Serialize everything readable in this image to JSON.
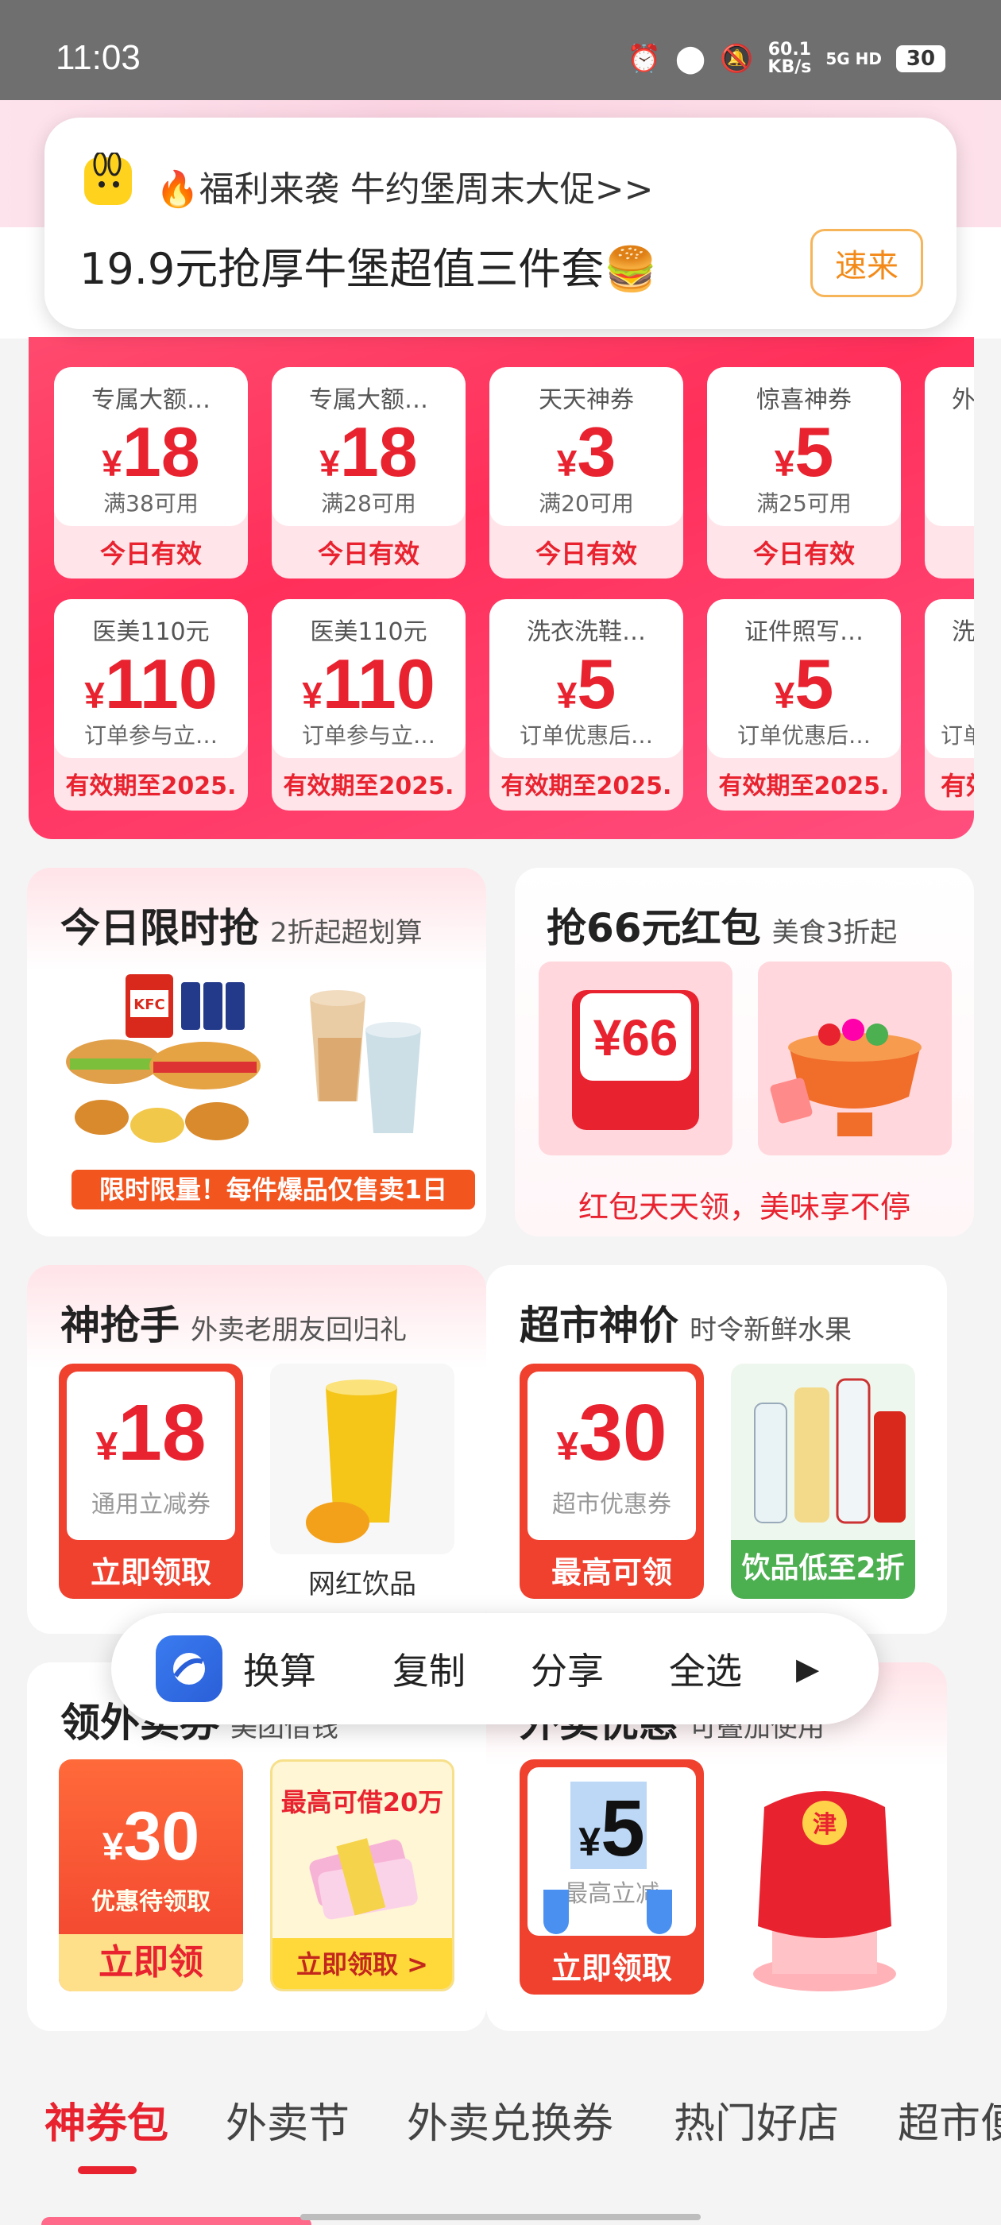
{
  "status_bar": {
    "time": "11:03",
    "net_speed": "60.1",
    "net_unit": "KB/s",
    "signal": "5G HD",
    "battery": "30"
  },
  "notification": {
    "line1": "🔥福利来袭 牛约堡周末大促>>",
    "line2": "19.9元抢厚牛堡超值三件套🍔",
    "button": "速来"
  },
  "coupons_row1": [
    {
      "title": "专属大额…",
      "yen": "¥",
      "amount": "18",
      "cond": "满38可用",
      "valid": "今日有效"
    },
    {
      "title": "专属大额…",
      "yen": "¥",
      "amount": "18",
      "cond": "满28可用",
      "valid": "今日有效"
    },
    {
      "title": "天天神券",
      "yen": "¥",
      "amount": "3",
      "cond": "满20可用",
      "valid": "今日有效"
    },
    {
      "title": "惊喜神券",
      "yen": "¥",
      "amount": "5",
      "cond": "满25可用",
      "valid": "今日有效"
    },
    {
      "title": "外",
      "yen": "",
      "amount": "",
      "cond": "",
      "valid": ""
    }
  ],
  "coupons_row2": [
    {
      "title": "医美110元",
      "yen": "¥",
      "amount": "110",
      "cond": "订单参与立…",
      "valid": "有效期至2025."
    },
    {
      "title": "医美110元",
      "yen": "¥",
      "amount": "110",
      "cond": "订单参与立…",
      "valid": "有效期至2025."
    },
    {
      "title": "洗衣洗鞋…",
      "yen": "¥",
      "amount": "5",
      "cond": "订单优惠后…",
      "valid": "有效期至2025."
    },
    {
      "title": "证件照写…",
      "yen": "¥",
      "amount": "5",
      "cond": "订单优惠后…",
      "valid": "有效期至2025."
    },
    {
      "title": "洗",
      "yen": "",
      "amount": "",
      "cond": "订单",
      "valid": "有效"
    }
  ],
  "card_flash": {
    "title": "今日限时抢",
    "subtitle": "2折起超划算",
    "banner": "限时限量！每件爆品仅售卖1日",
    "bucket_text": "KFC"
  },
  "card_redpacket": {
    "title": "抢66元红包",
    "subtitle": "美食3折起",
    "packet_text": "¥66",
    "footer": "红包天天领，美味享不停"
  },
  "card_grabber": {
    "title": "神抢手",
    "subtitle": "外卖老朋友回归礼",
    "yen": "¥",
    "amount": "18",
    "desc": "通用立减券",
    "action": "立即领取",
    "product_label": "网红饮品"
  },
  "card_market": {
    "title": "超市神价",
    "subtitle": "时令新鲜水果",
    "yen": "¥",
    "amount": "30",
    "desc": "超市优惠券",
    "action": "最高可领",
    "banner": "饮品低至2折"
  },
  "card_lingwai": {
    "title": "领外卖券",
    "subtitle": "美团借钱",
    "yen": "¥",
    "amount": "30",
    "desc": "优惠待领取",
    "action": "立即领",
    "loan_title": "最高可借20万",
    "loan_action": "立即领取 >"
  },
  "card_youhui": {
    "title": "外卖优惠",
    "subtitle": "可叠加使用",
    "yen": "¥",
    "amount": "5",
    "desc": "最高立减",
    "action": "立即领取",
    "bag_char": "津"
  },
  "toolbar": {
    "item1": "换算",
    "item2": "复制",
    "item3": "分享",
    "item4": "全选",
    "more": "▶"
  },
  "tabs": [
    "神券包",
    "外卖节",
    "外卖兑换券",
    "热门好店",
    "超市便"
  ],
  "colors": {
    "accent": "#e8232f",
    "panel": "#ff2f5a",
    "toolbar_icon": "#2a5fd8"
  }
}
